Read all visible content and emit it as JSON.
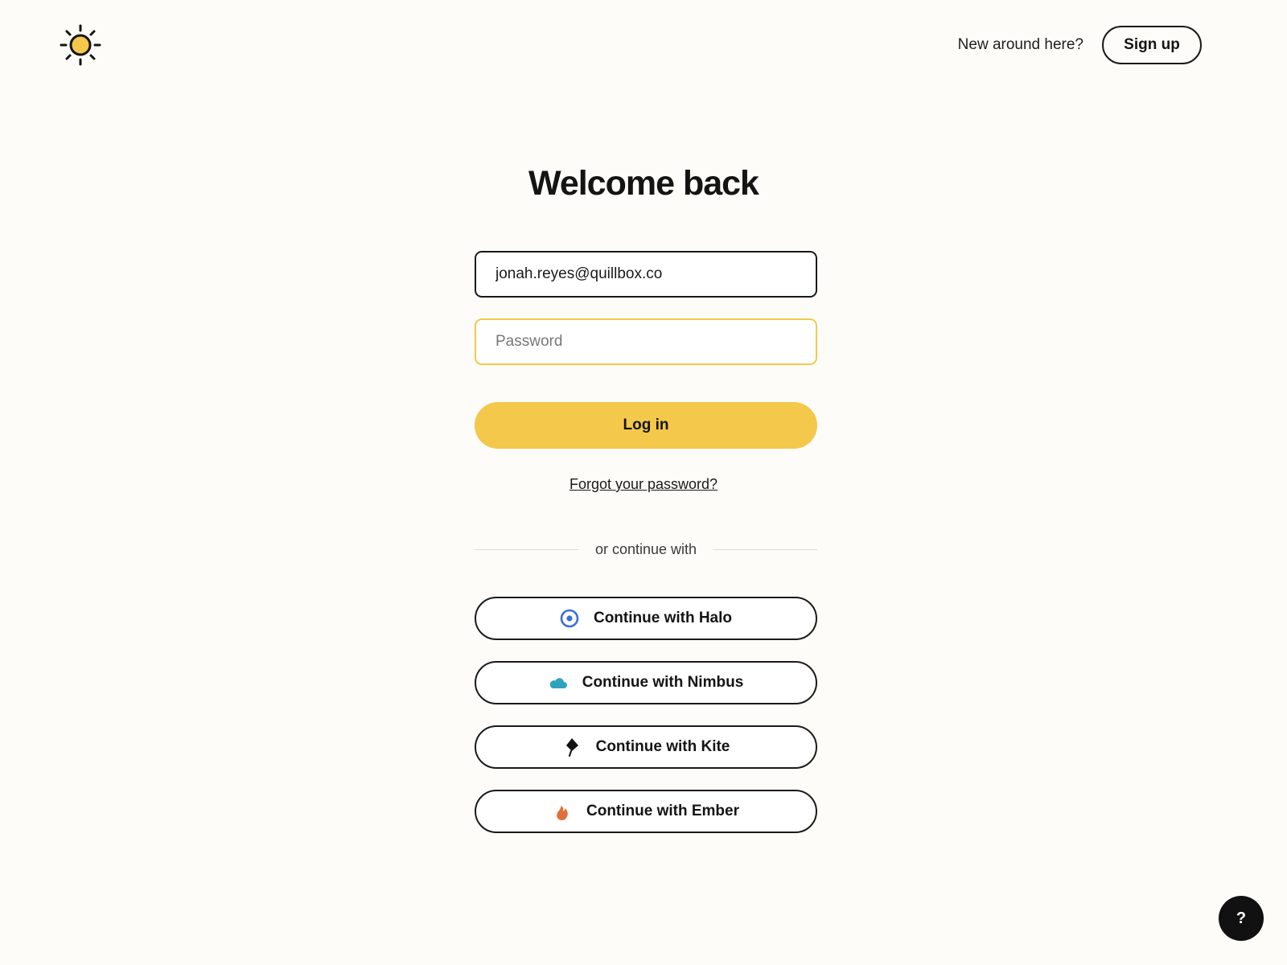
{
  "header": {
    "logo_icon": "sun-icon",
    "new_around_text": "New around here?",
    "signup_label": "Sign up"
  },
  "main": {
    "title": "Welcome back",
    "email": {
      "value": "jonah.reyes@quillbox.co"
    },
    "password": {
      "placeholder": "Password",
      "value": ""
    },
    "login_label": "Log in",
    "forgot_label": "Forgot your password?",
    "divider_text": "or continue with",
    "sso": [
      {
        "label": "Continue with Halo",
        "icon": "halo-icon",
        "color": "#3b6fd8"
      },
      {
        "label": "Continue with Nimbus",
        "icon": "cloud-icon",
        "color": "#2fa3bd"
      },
      {
        "label": "Continue with Kite",
        "icon": "kite-icon",
        "color": "#111111"
      },
      {
        "label": "Continue with Ember",
        "icon": "flame-icon",
        "color": "#e0703a"
      }
    ]
  },
  "help": {
    "label": "?"
  },
  "colors": {
    "accent": "#f4c84a",
    "background": "#fdfcf8",
    "text": "#141414",
    "focus_border": "#f2c94c"
  }
}
